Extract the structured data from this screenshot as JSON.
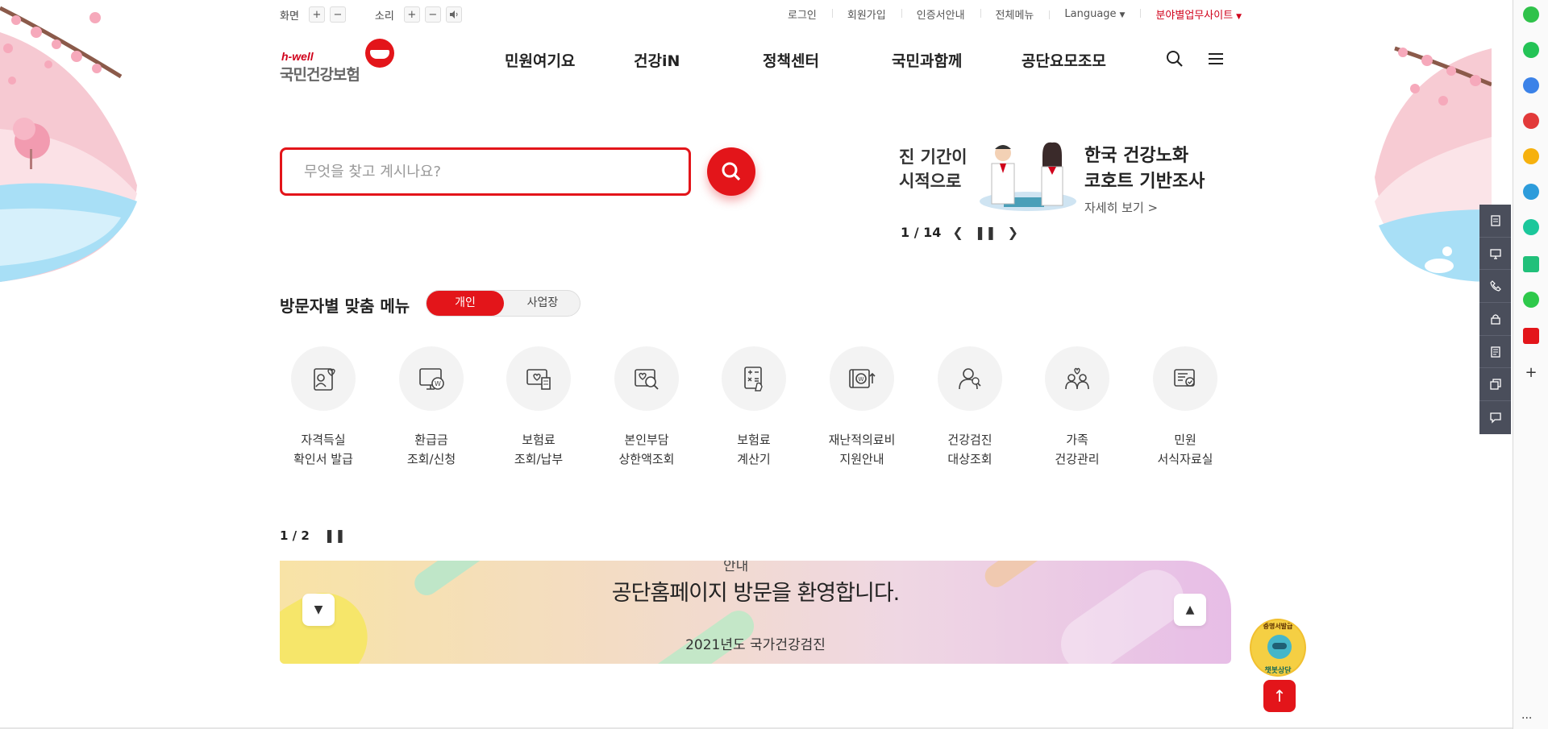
{
  "utility": {
    "screen_label": "화면",
    "sound_label": "소리",
    "plus": "+",
    "minus": "−",
    "links": [
      "로그인",
      "회원가입",
      "인증서안내",
      "전체메뉴"
    ],
    "language": "Language",
    "field_sites": "분야별업무사이트"
  },
  "logo": {
    "brand": "h-well",
    "name": "국민건강보험"
  },
  "gnb": {
    "items": [
      "민원여기요",
      "건강iN",
      "정책센터",
      "국민과함께",
      "공단요모조모"
    ]
  },
  "search": {
    "placeholder": "무엇을 찾고 계시나요?"
  },
  "banner": {
    "prev_line1": "진 기간이",
    "prev_line2": "시적으로",
    "title_line1": "한국 건강노화",
    "title_line2": "코호트 기반조사",
    "more": "자세히 보기 >",
    "current": "1",
    "total": "/ 14"
  },
  "visitor_menu": {
    "title": "방문자별 맞춤 메뉴",
    "tab_personal": "개인",
    "tab_business": "사업장",
    "items": [
      {
        "label": "자격득실\n확인서 발급",
        "icon": "certificate-icon"
      },
      {
        "label": "환급금\n조회/신청",
        "icon": "refund-icon"
      },
      {
        "label": "보험료\n조회/납부",
        "icon": "premium-payment-icon"
      },
      {
        "label": "본인부담\n상한액조회",
        "icon": "copay-ceiling-icon"
      },
      {
        "label": "보험료\n계산기",
        "icon": "calculator-icon"
      },
      {
        "label": "재난적의료비\n지원안내",
        "icon": "medical-expense-icon"
      },
      {
        "label": "건강검진\n대상조회",
        "icon": "checkup-target-icon"
      },
      {
        "label": "가족\n건강관리",
        "icon": "family-health-icon"
      },
      {
        "label": "민원\n서식자료실",
        "icon": "forms-library-icon"
      }
    ]
  },
  "notice": {
    "current": "1",
    "total": "/ 2",
    "prev_text": "안내",
    "headline": "공단홈페이지 방문을 환영합니다.",
    "next_text": "2021년도 국가건강검진"
  },
  "chatbot": {
    "top_text": "증명서발급",
    "bottom_text": "챗봇상담"
  },
  "colors": {
    "brand_red": "#e3151a",
    "quickbar_bg": "#4a4e5b"
  }
}
